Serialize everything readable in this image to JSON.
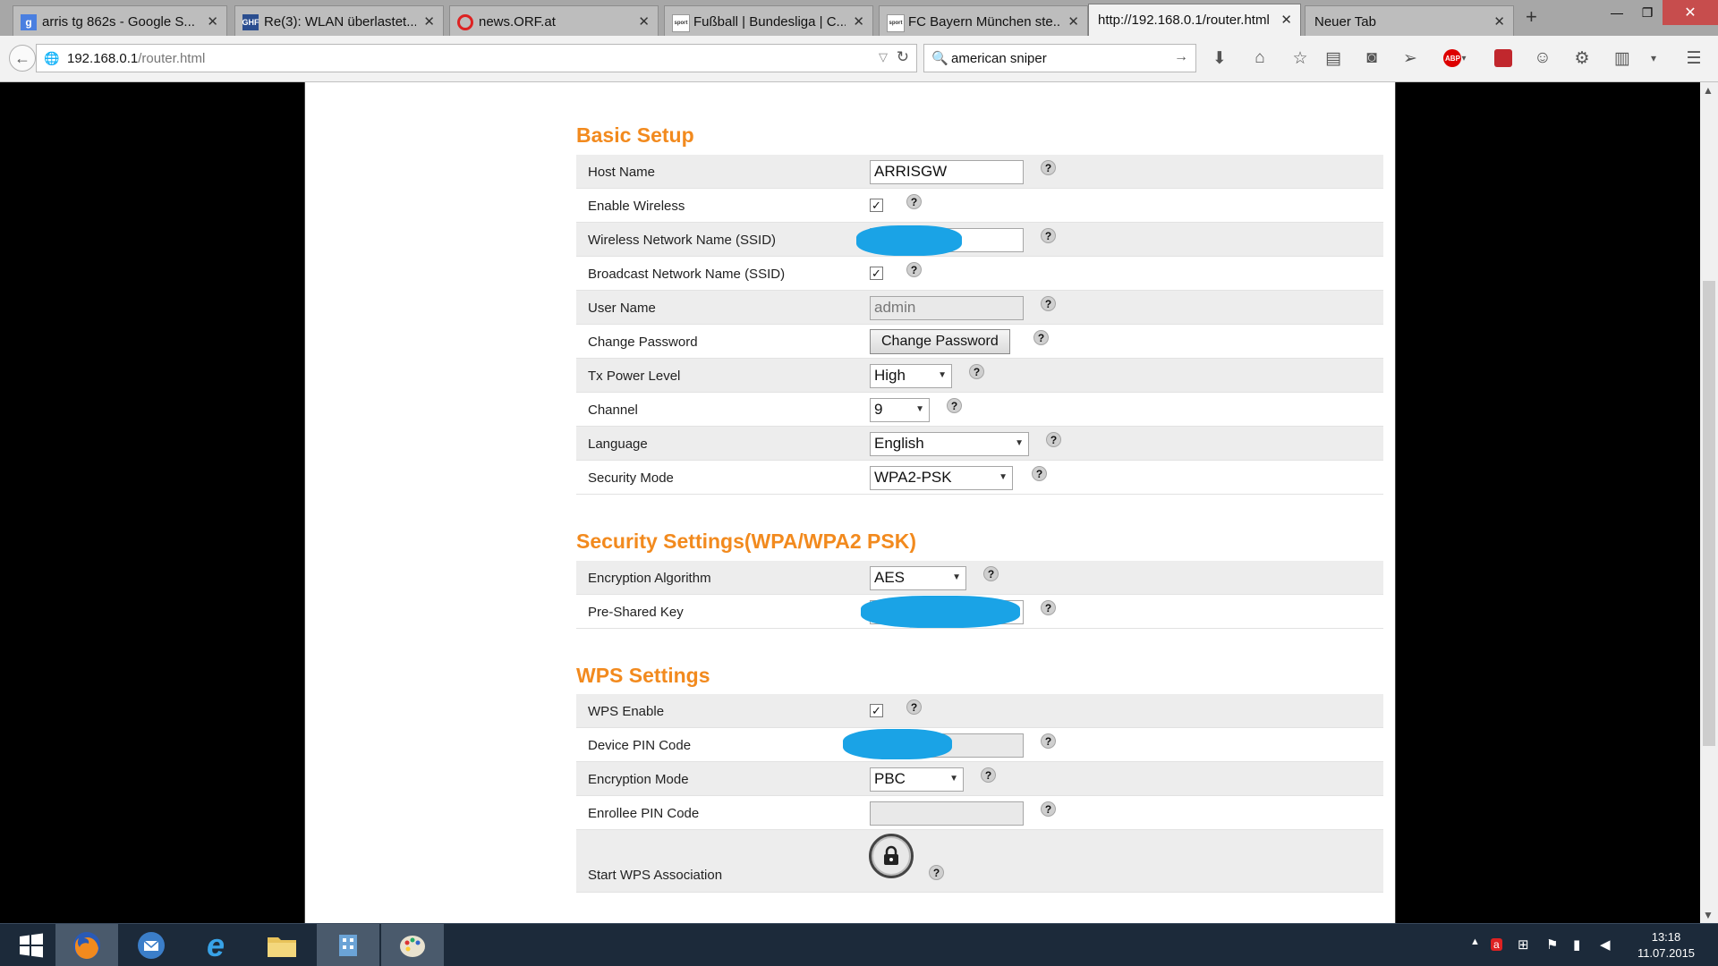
{
  "browser": {
    "tabs": [
      {
        "title": "arris tg 862s - Google S...",
        "icon": "google-icon"
      },
      {
        "title": "Re(3): WLAN überlastet...",
        "icon": "ghf-icon"
      },
      {
        "title": "news.ORF.at",
        "icon": "orf-icon"
      },
      {
        "title": "Fußball | Bundesliga | C...",
        "icon": "sport-icon"
      },
      {
        "title": "FC Bayern München ste...",
        "icon": "sport-icon"
      },
      {
        "title": "http://192.168.0.1/router.html",
        "icon": "",
        "active": true
      },
      {
        "title": "Neuer Tab",
        "icon": ""
      }
    ],
    "url_host": "192.168.0.1",
    "url_path": "/router.html",
    "search_text": "american sniper"
  },
  "basic_setup": {
    "title": "Basic Setup",
    "host_name_label": "Host Name",
    "host_name_value": "ARRISGW",
    "enable_wireless_label": "Enable Wireless",
    "ssid_label": "Wireless Network Name (SSID)",
    "broadcast_label": "Broadcast Network Name (SSID)",
    "user_name_label": "User Name",
    "user_name_value": "admin",
    "change_password_label": "Change Password",
    "change_password_button": "Change Password",
    "tx_power_label": "Tx Power Level",
    "tx_power_value": "High",
    "channel_label": "Channel",
    "channel_value": "9",
    "language_label": "Language",
    "language_value": "English",
    "security_mode_label": "Security Mode",
    "security_mode_value": "WPA2-PSK"
  },
  "security_settings": {
    "title": "Security Settings(WPA/WPA2 PSK)",
    "encryption_algorithm_label": "Encryption Algorithm",
    "encryption_algorithm_value": "AES",
    "psk_label": "Pre-Shared Key"
  },
  "wps_settings": {
    "title": "WPS Settings",
    "wps_enable_label": "WPS Enable",
    "device_pin_label": "Device PIN Code",
    "encryption_mode_label": "Encryption Mode",
    "encryption_mode_value": "PBC",
    "enrollee_pin_label": "Enrollee PIN Code",
    "start_wps_label": "Start WPS Association"
  },
  "help_glyph": "?",
  "taskbar": {
    "time": "13:18",
    "date": "11.07.2015"
  },
  "colors": {
    "section_title": "#f28a1e",
    "redaction": "#1aa3e6",
    "row_alt": "#ededed"
  }
}
